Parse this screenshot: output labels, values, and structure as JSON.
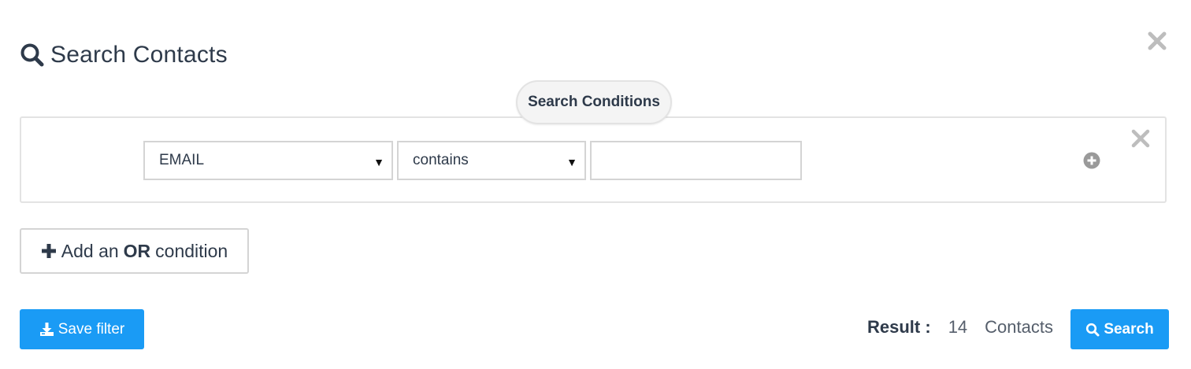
{
  "dialog": {
    "title": "Search Contacts",
    "title_icon": "search-icon",
    "close_icon": "close-icon"
  },
  "conditions": {
    "heading": "Search Conditions",
    "rows": [
      {
        "field": "EMAIL",
        "operator": "contains",
        "value": "",
        "add_icon": "plus-circle-icon",
        "remove_icon": "close-icon"
      }
    ]
  },
  "or_button": {
    "prefix": "Add an",
    "emphasis": "OR",
    "suffix": "condition",
    "icon": "plus-icon"
  },
  "footer": {
    "save_label": "Save filter",
    "save_icon": "download-icon",
    "result_label": "Result :",
    "result_count": "14",
    "result_unit": "Contacts",
    "search_label": "Search",
    "search_icon": "search-icon"
  },
  "colors": {
    "primary": "#1a9bf5",
    "text": "#2e3a4a",
    "border": "#d4d4d4",
    "muted_icon": "#b5b5b5"
  }
}
